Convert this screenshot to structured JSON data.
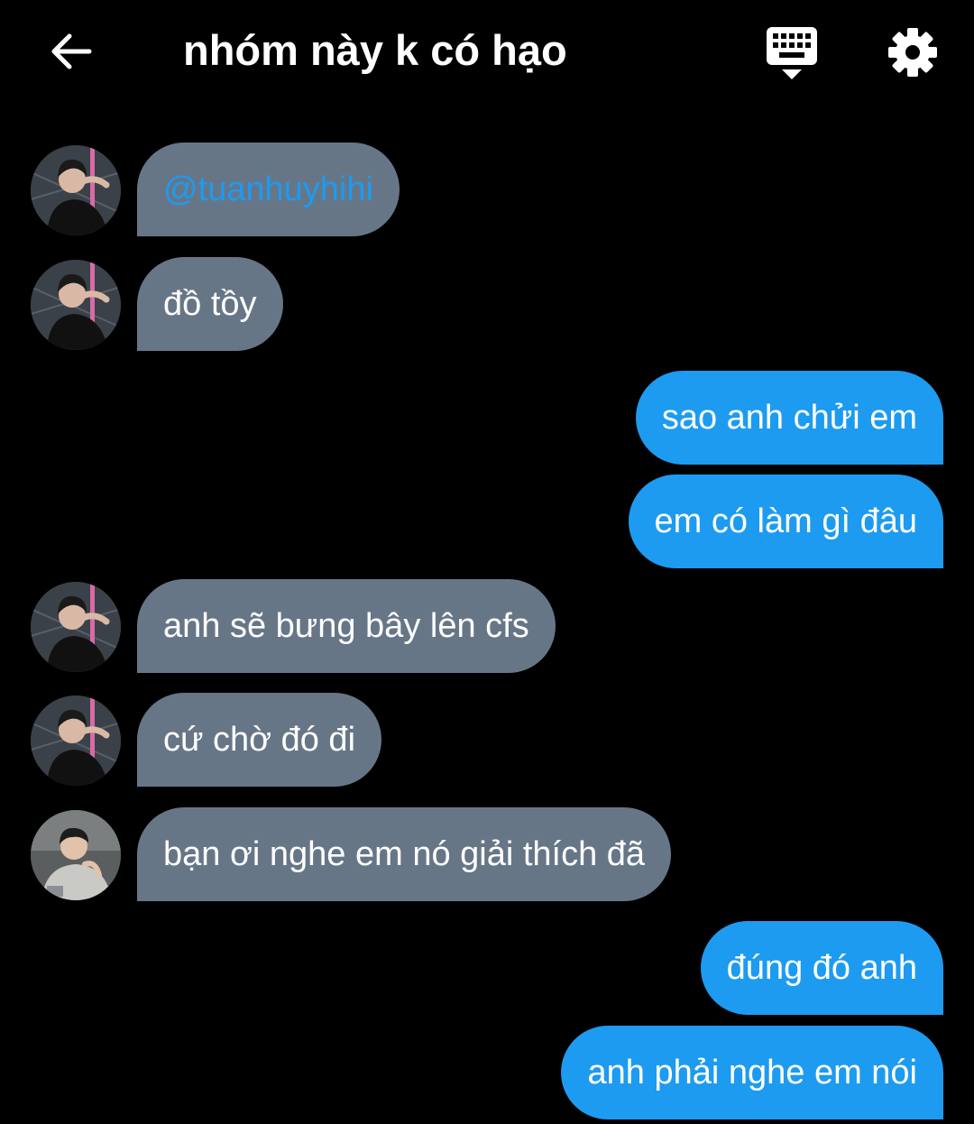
{
  "header": {
    "title": "nhóm này k có hạo",
    "back_icon": "arrow-left-icon",
    "keyboard_icon": "keyboard-hide-icon",
    "settings_icon": "gear-icon"
  },
  "colors": {
    "background": "#000000",
    "incoming_bubble": "#677687",
    "outgoing_bubble": "#1d9bf0",
    "mention": "#1d9bf0",
    "text": "#ffffff"
  },
  "messages": [
    {
      "direction": "in",
      "text": "@tuanhuyhihi",
      "is_mention": true
    },
    {
      "direction": "in",
      "text": "đồ tồy"
    },
    {
      "direction": "out",
      "text": "sao anh chửi em"
    },
    {
      "direction": "out",
      "text": "em có làm gì đâu"
    },
    {
      "direction": "in",
      "text": "anh sẽ bưng bây lên cfs"
    },
    {
      "direction": "in",
      "text": "cứ chờ đó đi"
    },
    {
      "direction": "in",
      "text": "bạn ơi nghe em nó giải thích đã"
    },
    {
      "direction": "out",
      "text": "đúng đó anh"
    },
    {
      "direction": "out",
      "text": "anh phải nghe em nói"
    }
  ]
}
